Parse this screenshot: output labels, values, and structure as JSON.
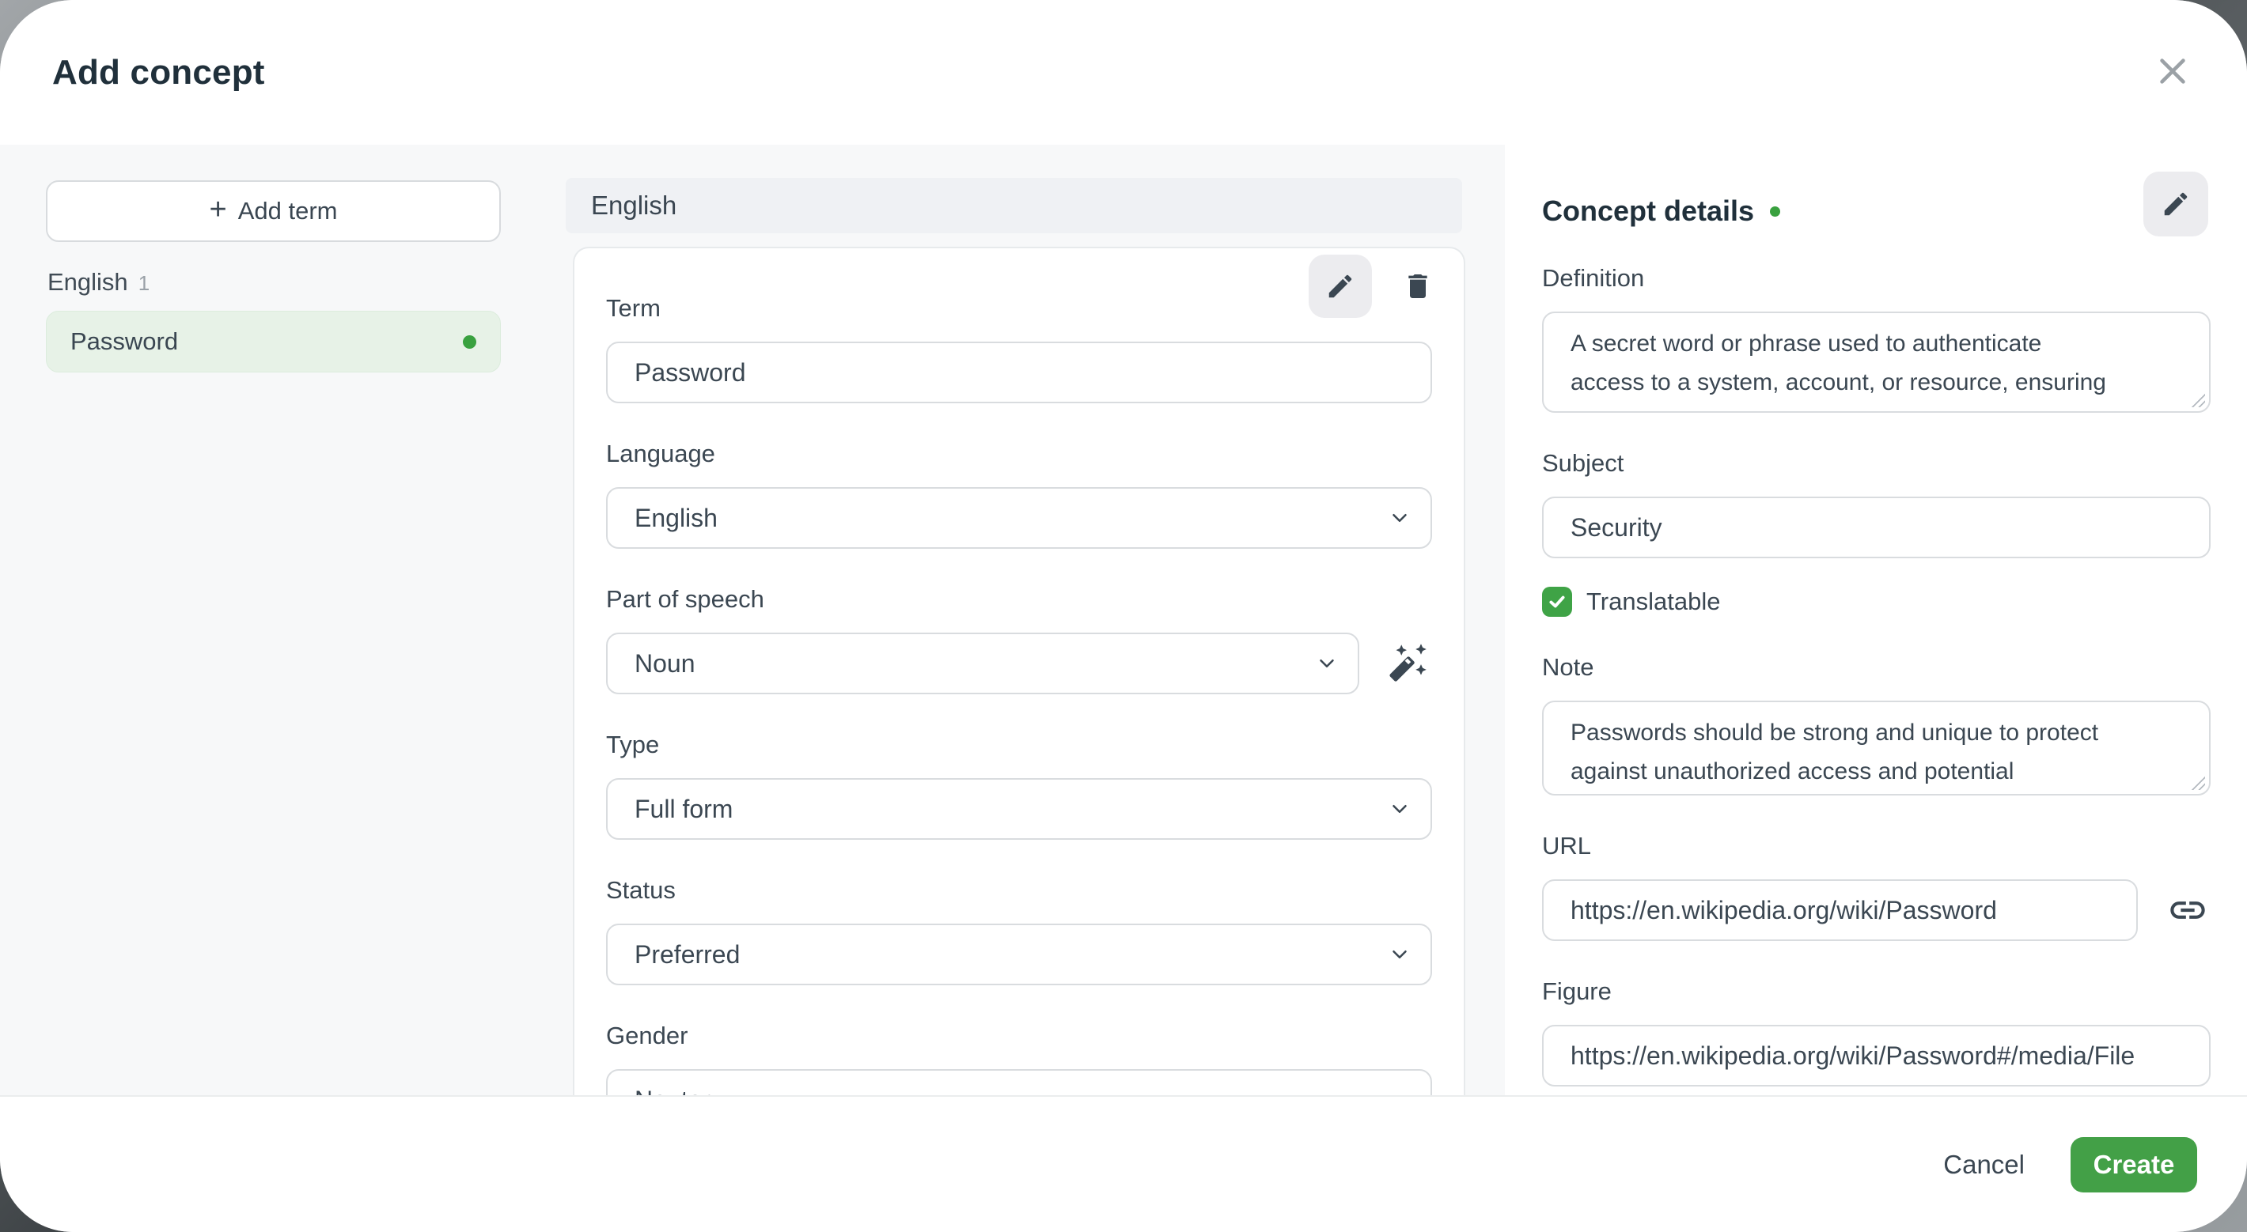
{
  "dialog": {
    "title": "Add concept"
  },
  "colors": {
    "accent_green": "#43a047",
    "term_highlight_bg": "#e7f2e7",
    "status_dot_green": "#39a13f",
    "checkbox_green": "#3fa346",
    "body_gray": "#f7f8f9",
    "section_bar_gray": "#eff1f4"
  },
  "icons": {
    "close-icon": "x-cross",
    "plus-icon": "+",
    "edit-icon": "pencil",
    "delete-icon": "trash-can",
    "chevron-down-icon": "v",
    "magic-wand-icon": "wand-with-sparkles",
    "check-icon": "checkmark",
    "link-icon": "chain-link",
    "resize-handle-icon": "diagonal-grip"
  },
  "sidebar": {
    "add_term_plus": "+",
    "add_term_label": "Add term",
    "group": {
      "language": "English",
      "count": "1"
    },
    "terms": [
      {
        "label": "Password"
      }
    ]
  },
  "term_section": {
    "header": "English",
    "term": {
      "label": "Term",
      "value": "Password"
    },
    "language": {
      "label": "Language",
      "value": "English"
    },
    "part_of_speech": {
      "label": "Part of speech",
      "value": "Noun"
    },
    "type": {
      "label": "Type",
      "value": "Full form"
    },
    "status": {
      "label": "Status",
      "value": "Preferred"
    },
    "gender": {
      "label": "Gender",
      "value": "Neuter"
    }
  },
  "details": {
    "title": "Concept details",
    "definition": {
      "label": "Definition",
      "value": "A secret word or phrase used to authenticate\naccess to a system, account, or resource, ensuring\nthat only authorized users can gain entry."
    },
    "subject": {
      "label": "Subject",
      "value": "Security"
    },
    "translatable": {
      "label": "Translatable",
      "checked": true
    },
    "note": {
      "label": "Note",
      "value": "Passwords should be strong and unique to protect\nagainst unauthorized access and potential\nbreaches."
    },
    "url": {
      "label": "URL",
      "value": "https://en.wikipedia.org/wiki/Password"
    },
    "figure": {
      "label": "Figure",
      "value": "https://en.wikipedia.org/wiki/Password#/media/File"
    }
  },
  "footer": {
    "cancel_label": "Cancel",
    "create_label": "Create"
  }
}
